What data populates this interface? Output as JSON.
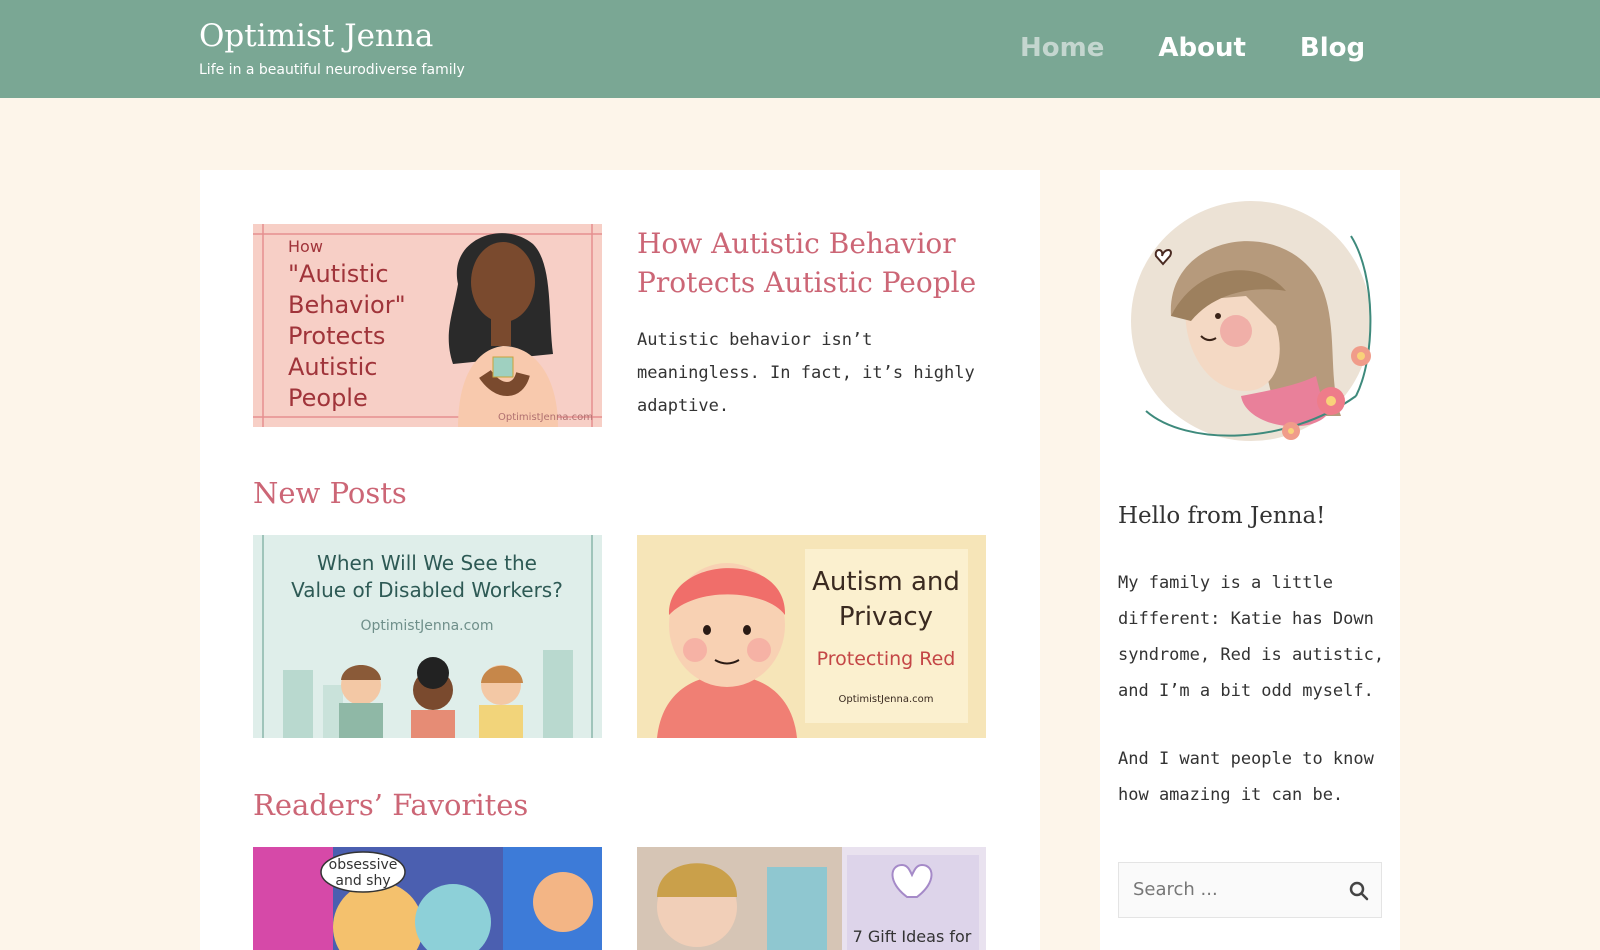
{
  "site": {
    "title": "Optimist Jenna",
    "tagline": "Life in a beautiful neurodiverse family"
  },
  "nav": {
    "items": [
      {
        "label": "Home",
        "current": true
      },
      {
        "label": "About",
        "current": false
      },
      {
        "label": "Blog",
        "current": false
      }
    ]
  },
  "featured": {
    "title": "How Autistic Behavior Protects Autistic People",
    "excerpt": "Autistic behavior isn’t meaningless. In fact, it’s highly adaptive.",
    "image": {
      "small": "How",
      "line1": "\"Autistic",
      "line2": "Behavior\"",
      "line3": "Protects",
      "line4": "Autistic",
      "line5": "People",
      "watermark": "OptimistJenna.com"
    }
  },
  "new_posts": {
    "heading": "New Posts",
    "post1": {
      "line1": "When Will We See the",
      "line2": "Value of Disabled Workers?",
      "site": "OptimistJenna.com"
    },
    "post2": {
      "line1": "Autism and",
      "line2": "Privacy",
      "line3": "Protecting Red",
      "site": "OptimistJenna.com"
    }
  },
  "favorites": {
    "heading": "Readers’ Favorites",
    "post1": {
      "bubble1": "obsessive",
      "bubble2": "and shy"
    },
    "post2": {
      "caption": "7 Gift Ideas for"
    }
  },
  "sidebar": {
    "hello": "Hello from Jenna!",
    "bio1": "My family is a little different: Katie has Down syndrome, Red is autistic, and I’m a bit odd myself.",
    "bio2": "And I want people to know how amazing it can be.",
    "search_placeholder": "Search ..."
  },
  "colors": {
    "header_bg": "#7aa794",
    "page_bg": "#fdf5ea",
    "accent": "#cc6676"
  }
}
